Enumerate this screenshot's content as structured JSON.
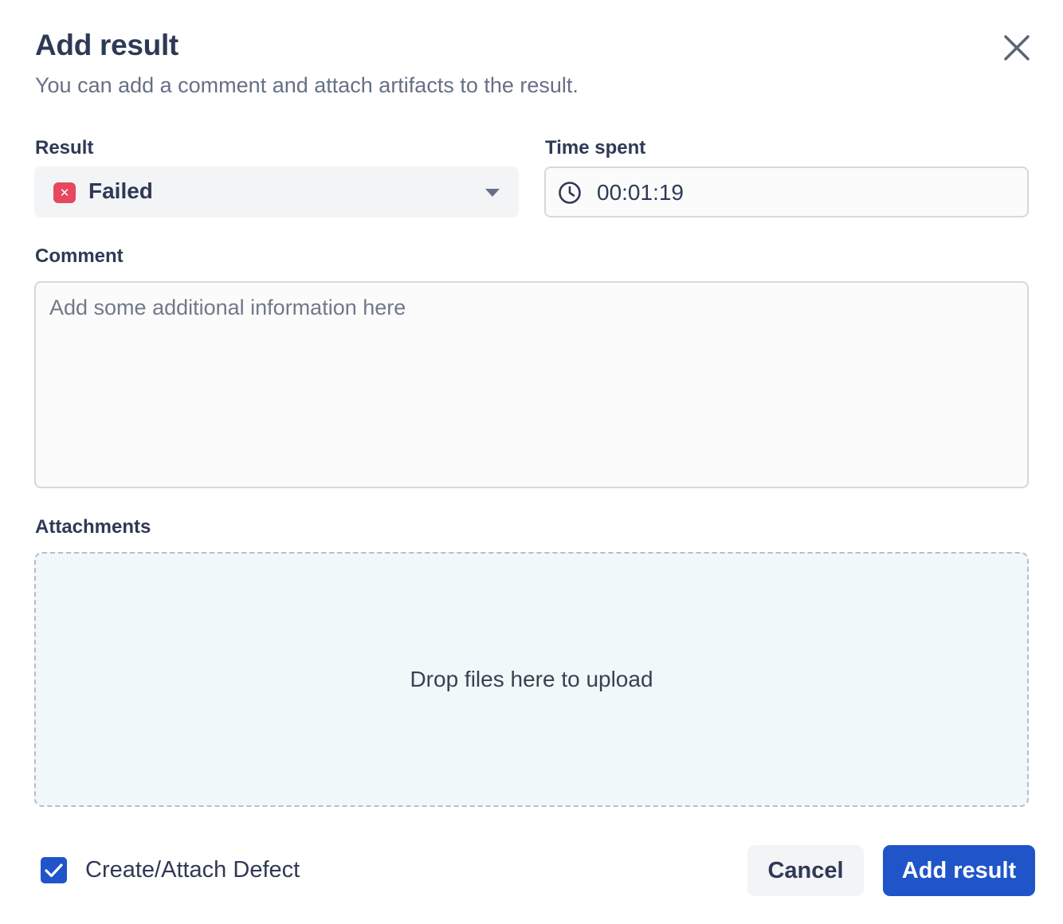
{
  "dialog": {
    "title": "Add result",
    "subtitle": "You can add a comment and attach artifacts to the result.",
    "close_icon": "close-icon"
  },
  "result": {
    "label": "Result",
    "value": "Failed",
    "status_icon": "x-icon",
    "status_color": "#e5485f"
  },
  "time_spent": {
    "label": "Time spent",
    "value": "00:01:19",
    "icon": "clock-icon"
  },
  "comment": {
    "label": "Comment",
    "value": "",
    "placeholder": "Add some additional information here"
  },
  "attachments": {
    "label": "Attachments",
    "dropzone_text": "Drop files here to upload"
  },
  "defect": {
    "label": "Create/Attach Defect",
    "checked": true
  },
  "actions": {
    "cancel_label": "Cancel",
    "submit_label": "Add result"
  },
  "colors": {
    "primary": "#1f55c9",
    "failed": "#e5485f",
    "dropzone_bg": "#f1f8fa"
  }
}
